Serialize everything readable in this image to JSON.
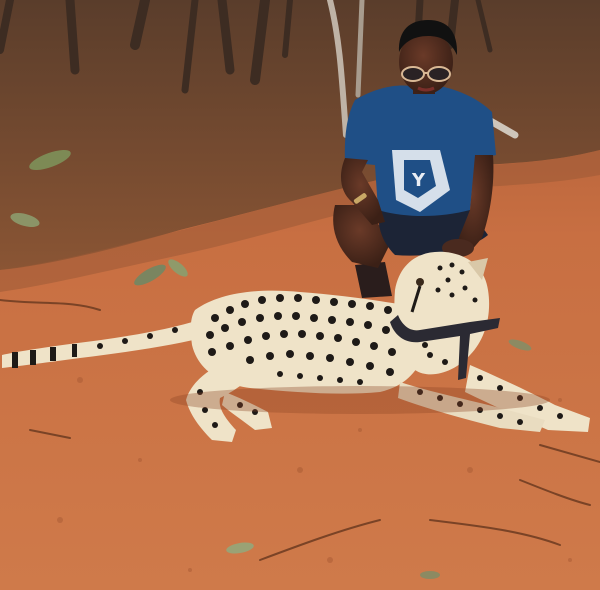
{
  "scene": {
    "colors": {
      "soil": "#c86f42",
      "soil_light": "#d88a5c",
      "soil_dark": "#9a4f2c",
      "litter": "#6b4a35",
      "trunk": "#3d2c22",
      "shirt": "#1f4f86",
      "skin": "#4a2a1f",
      "cheetah_fur": "#efe3c8",
      "cheetah_spot": "#1e1a17",
      "harness": "#2b2a33"
    },
    "shirt_print": "Y"
  }
}
